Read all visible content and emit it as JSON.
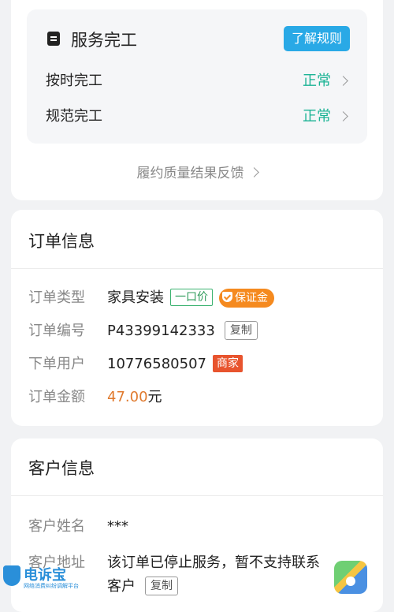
{
  "service": {
    "title": "服务完工",
    "rule_button": "了解规则",
    "rows": [
      {
        "label": "按时完工",
        "status": "正常"
      },
      {
        "label": "规范完工",
        "status": "正常"
      }
    ],
    "feedback_link": "履约质量结果反馈"
  },
  "order": {
    "title": "订单信息",
    "type_label": "订单类型",
    "type_value": "家具安装",
    "type_tag": "一口价",
    "deposit_tag": "保证金",
    "number_label": "订单编号",
    "number_value": "P43399142333",
    "copy_label": "复制",
    "user_label": "下单用户",
    "user_value": "10776580507",
    "user_tag": "商家",
    "amount_label": "订单金额",
    "amount_value": "47.00",
    "amount_unit": "元"
  },
  "customer": {
    "title": "客户信息",
    "name_label": "客户姓名",
    "name_value": "***",
    "address_label": "客户地址",
    "address_value": "该订单已停止服务，暂不支持联系客户",
    "copy_label": "复制"
  },
  "watermark": {
    "name": "电诉宝",
    "sub": "网络消费纠纷调解平台"
  }
}
